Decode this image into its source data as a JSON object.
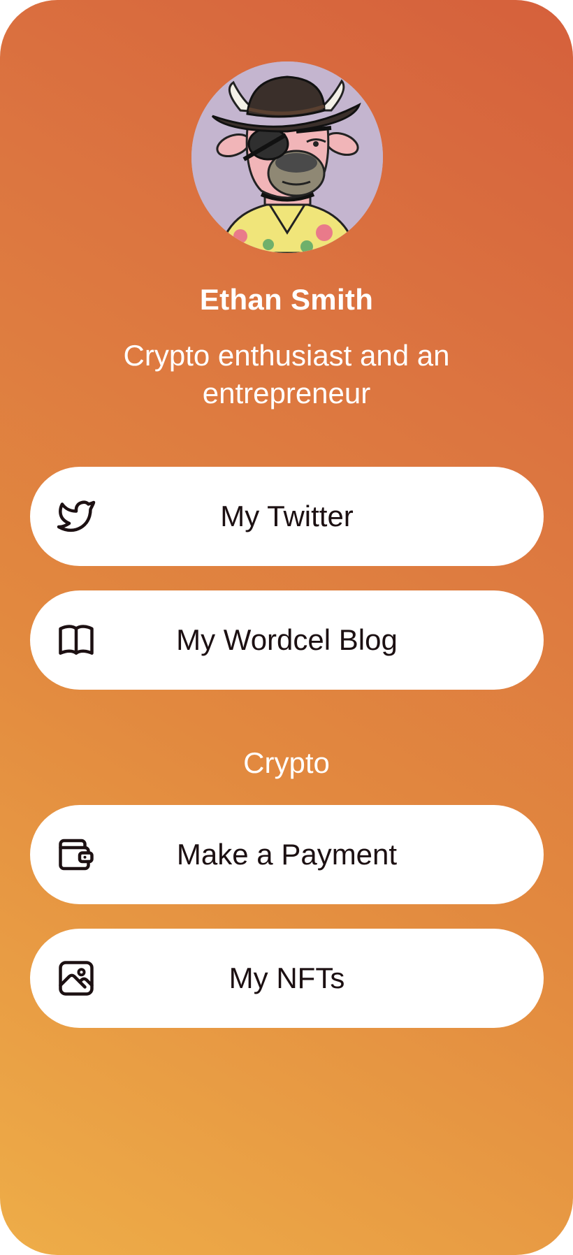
{
  "profile": {
    "name": "Ethan Smith",
    "bio": "Crypto enthusiast and an entrepreneur",
    "avatar_icon": "cowboy-bull-nft-avatar"
  },
  "links": [
    {
      "label": "My Twitter",
      "icon": "twitter-icon"
    },
    {
      "label": "My Wordcel Blog",
      "icon": "book-icon"
    }
  ],
  "crypto_section": {
    "title": "Crypto",
    "links": [
      {
        "label": "Make a Payment",
        "icon": "wallet-icon"
      },
      {
        "label": "My NFTs",
        "icon": "image-icon"
      }
    ]
  },
  "colors": {
    "gradient_top": "#d5603c",
    "gradient_bottom": "#eead48",
    "button_bg": "#ffffff",
    "button_text": "#1c1012",
    "header_text": "#ffffff"
  }
}
